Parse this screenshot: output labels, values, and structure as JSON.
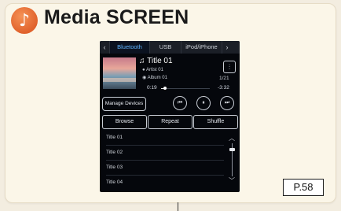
{
  "header": {
    "title": "Media SCREEN",
    "icon": "music-note-icon"
  },
  "tabs": [
    {
      "label": "Bluetooth",
      "active": true
    },
    {
      "label": "USB",
      "active": false
    },
    {
      "label": "iPod/iPhone",
      "active": false
    }
  ],
  "now_playing": {
    "title": "Title 01",
    "artist": "Artist 01",
    "album": "Album 01",
    "elapsed": "0:19",
    "remaining": "-3:32",
    "track_count": "1/21",
    "progress_fraction": 0.08
  },
  "controls": {
    "manage_devices": "Manage Devices",
    "browse": "Browse",
    "repeat": "Repeat",
    "shuffle": "Shuffle"
  },
  "list": [
    {
      "label": "Title 01"
    },
    {
      "label": "Title 02"
    },
    {
      "label": "Title 03"
    },
    {
      "label": "Title 04"
    }
  ],
  "page_ref": "P.58",
  "colors": {
    "accent": "#e86f35",
    "active_tab": "#5fb3ff",
    "screen_bg": "#05070c"
  }
}
